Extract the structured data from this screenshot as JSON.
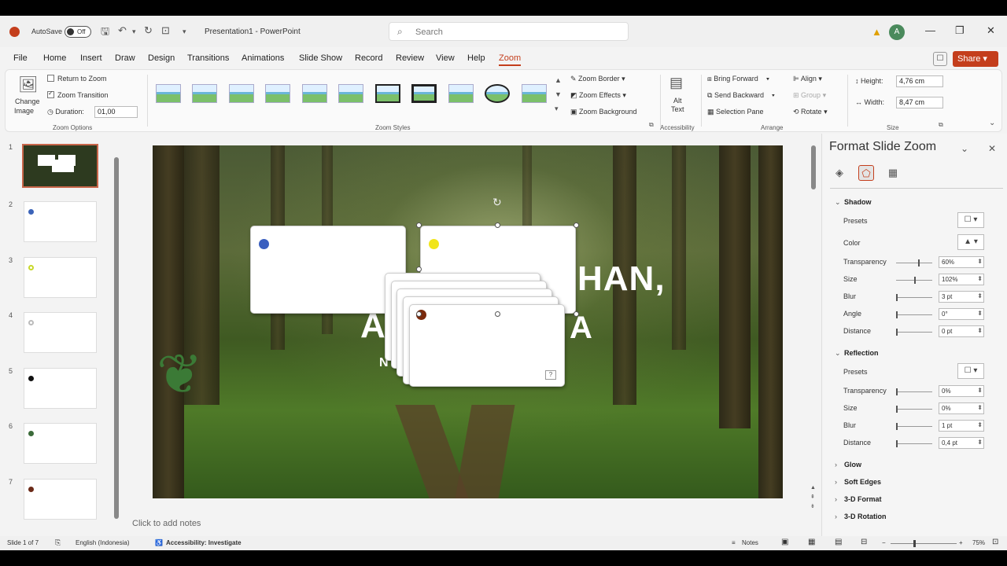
{
  "app": {
    "autosave_label": "AutoSave",
    "autosave_state": "Off",
    "doc_title": "Presentation1 - PowerPoint",
    "search_placeholder": "Search",
    "user_initial": "A"
  },
  "menu_tabs": [
    "File",
    "Home",
    "Insert",
    "Draw",
    "Design",
    "Transitions",
    "Animations",
    "Slide Show",
    "Record",
    "Review",
    "View",
    "Help",
    "Zoom"
  ],
  "active_tab": "Zoom",
  "share_label": "Share",
  "ribbon": {
    "change_image": "Change\nImage",
    "change_image_l1": "Change",
    "change_image_l2": "Image",
    "return_to_zoom": "Return to Zoom",
    "zoom_transition": "Zoom Transition",
    "duration_label": "Duration:",
    "duration_value": "01,00",
    "zoom_options_label": "Zoom Options",
    "zoom_styles_label": "Zoom Styles",
    "zoom_border": "Zoom Border",
    "zoom_effects": "Zoom Effects",
    "zoom_background": "Zoom Background",
    "alt_text_l1": "Alt",
    "alt_text_l2": "Text",
    "accessibility_label": "Accessibility",
    "bring_forward": "Bring Forward",
    "send_backward": "Send Backward",
    "selection_pane": "Selection Pane",
    "align": "Align",
    "group": "Group",
    "rotate": "Rotate",
    "arrange_label": "Arrange",
    "height_label": "Height:",
    "height_value": "4,76 cm",
    "width_label": "Width:",
    "width_value": "8,47 cm",
    "size_label": "Size"
  },
  "slides": [
    {
      "num": "1",
      "dot": null
    },
    {
      "num": "2",
      "dot": "#3b63b8"
    },
    {
      "num": "3",
      "dot": "#c8d82a"
    },
    {
      "num": "4",
      "dot": "#bbbbbb"
    },
    {
      "num": "5",
      "dot": "#111111"
    },
    {
      "num": "6",
      "dot": "#3c6b3a"
    },
    {
      "num": "7",
      "dot": "#6b2a18"
    }
  ],
  "slide": {
    "text_main": "HAN,",
    "text_partial_1": "A",
    "text_partial_2": "A",
    "text_partial_3": "N",
    "card_dot_colors": [
      "#3a5fbf",
      "#f1e51a",
      "#7a2a0c"
    ],
    "qmark": "?"
  },
  "notes_placeholder": "Click to add notes",
  "pane": {
    "title": "Format Slide Zoom",
    "shadow": {
      "label": "Shadow",
      "presets": "Presets",
      "color": "Color",
      "transparency": "Transparency",
      "transparency_val": "60%",
      "transparency_pct": 0.6,
      "size": "Size",
      "size_val": "102%",
      "size_pct": 0.51,
      "blur": "Blur",
      "blur_val": "3 pt",
      "angle": "Angle",
      "angle_val": "0°",
      "distance": "Distance",
      "distance_val": "0 pt"
    },
    "reflection": {
      "label": "Reflection",
      "presets": "Presets",
      "transparency": "Transparency",
      "transparency_val": "0%",
      "size": "Size",
      "size_val": "0%",
      "blur": "Blur",
      "blur_val": "1 pt",
      "distance": "Distance",
      "distance_val": "0,4 pt"
    },
    "collapsed_sections": [
      "Glow",
      "Soft Edges",
      "3-D Format",
      "3-D Rotation"
    ]
  },
  "status": {
    "slide_of": "Slide 1 of 7",
    "language": "English (Indonesia)",
    "accessibility": "Accessibility: Investigate",
    "notes": "Notes",
    "zoom": "75%"
  }
}
